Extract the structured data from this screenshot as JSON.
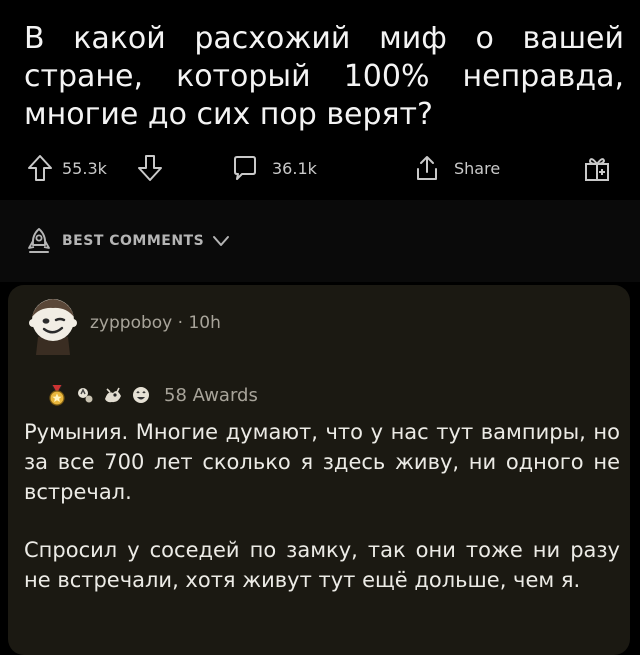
{
  "post": {
    "title": "В какой расхожий миф о вашей стране, который 100% неправда, многие до сих пор верят?",
    "upvotes": "55.3k",
    "comments": "36.1k",
    "share_label": "Share"
  },
  "sort": {
    "label": "BEST COMMENTS"
  },
  "comment": {
    "author": "zyppoboy",
    "separator": "·",
    "age": "10h",
    "awards": "58 Awards",
    "paragraphs": [
      "Румыния. Многие думают, что у нас тут вампиры, но за все 700 лет сколько я здесь живу, ни одного не встречал.",
      "Спросил у соседей по замку, так они тоже ни разу не встречали, хотя живут тут ещё дольше, чем я."
    ]
  },
  "colors": {
    "background": "#000000",
    "card": "#1b1912",
    "muted_text": "#a8a49a"
  },
  "icons": [
    "upvote-icon",
    "downvote-icon",
    "comment-icon",
    "share-icon",
    "gift-award-icon",
    "rocket-icon",
    "chevron-down-icon"
  ]
}
